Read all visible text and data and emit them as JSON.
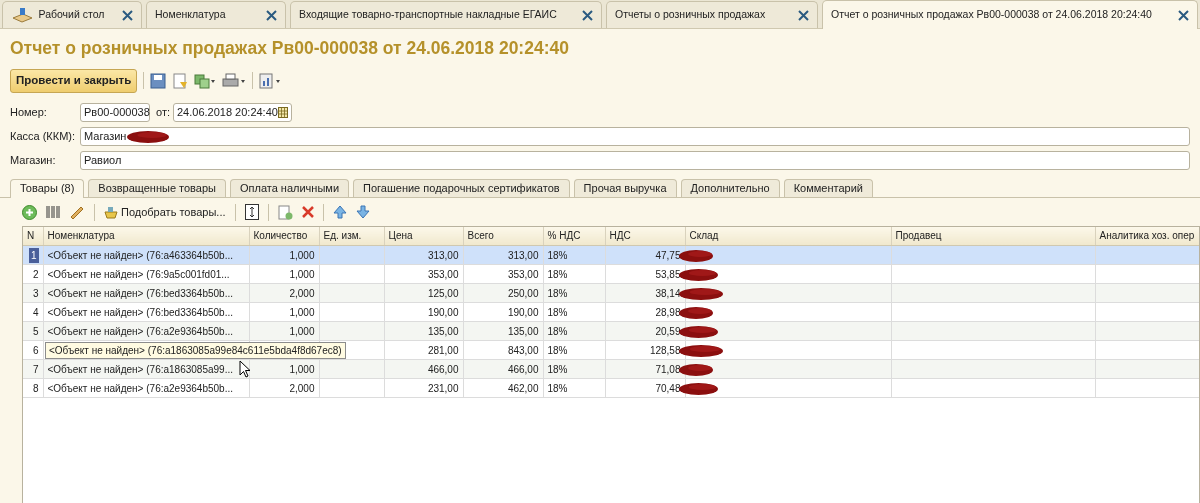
{
  "window_tabs": [
    {
      "label": "Рабочий стол",
      "kind": "desktop",
      "selected": false
    },
    {
      "label": "Номенклатура",
      "selected": false
    },
    {
      "label": "Входящие товарно-транспортные накладные ЕГАИС",
      "selected": false
    },
    {
      "label": "Отчеты о розничных продажах",
      "selected": false
    },
    {
      "label": "Отчет о розничных продажах Рв00-000038 от 24.06.2018 20:24:40",
      "selected": true
    }
  ],
  "title": "Отчет о розничных продажах Рв00-000038 от 24.06.2018 20:24:40",
  "toolbar": {
    "post_button": "Провести и закрыть"
  },
  "fields": {
    "number_label": "Номер:",
    "number_value": "Рв00-000038",
    "date_label": "от:",
    "date_value": "24.06.2018 20:24:40",
    "register_label": "Касса (ККМ):",
    "register_value": "Магазин",
    "shop_label": "Магазин:",
    "shop_value": "Равиол"
  },
  "inner_tabs": [
    {
      "label": "Товары (8)",
      "selected": true
    },
    {
      "label": "Возвращенные товары",
      "selected": false
    },
    {
      "label": "Оплата наличными",
      "selected": false
    },
    {
      "label": "Погашение подарочных сертификатов",
      "selected": false
    },
    {
      "label": "Прочая выручка",
      "selected": false
    },
    {
      "label": "Дополнительно",
      "selected": false
    },
    {
      "label": "Комментарий",
      "selected": false
    }
  ],
  "table_toolbar": {
    "pick_button": "Подобрать товары..."
  },
  "table": {
    "columns": [
      "N",
      "Номенклатура",
      "Количество",
      "Ед. изм.",
      "Цена",
      "Всего",
      "% НДС",
      "НДС",
      "Склад",
      "Продавец",
      "Аналитика хоз. опер"
    ],
    "rows": [
      {
        "n": "1",
        "item": "<Объект не найден> (76:a463364b50b...",
        "qty": "1,000",
        "price": "313,00",
        "total": "313,00",
        "vat_rate": "18%",
        "vat": "47,75",
        "selected": true
      },
      {
        "n": "2",
        "item": "<Объект не найден> (76:9a5c001fd01...",
        "qty": "1,000",
        "price": "353,00",
        "total": "353,00",
        "vat_rate": "18%",
        "vat": "53,85",
        "selected": false
      },
      {
        "n": "3",
        "item": "<Объект не найден> (76:bed3364b50b...",
        "qty": "2,000",
        "price": "125,00",
        "total": "250,00",
        "vat_rate": "18%",
        "vat": "38,14",
        "selected": false
      },
      {
        "n": "4",
        "item": "<Объект не найден> (76:bed3364b50b...",
        "qty": "1,000",
        "price": "190,00",
        "total": "190,00",
        "vat_rate": "18%",
        "vat": "28,98",
        "selected": false
      },
      {
        "n": "5",
        "item": "<Объект не найден> (76:a2e9364b50b...",
        "qty": "1,000",
        "price": "135,00",
        "total": "135,00",
        "vat_rate": "18%",
        "vat": "20,59",
        "selected": false
      },
      {
        "n": "6",
        "tooltip": "<Объект не найден> (76:a1863085a99e84c611e5bda4f8d67ec8)",
        "price": "281,00",
        "total": "843,00",
        "vat_rate": "18%",
        "vat": "128,58",
        "selected": false
      },
      {
        "n": "7",
        "item": "<Объект не найден> (76:a1863085a99...",
        "qty": "1,000",
        "price": "466,00",
        "total": "466,00",
        "vat_rate": "18%",
        "vat": "71,08",
        "selected": false
      },
      {
        "n": "8",
        "item": "<Объект не найден> (76:a2e9364b50b...",
        "qty": "2,000",
        "price": "231,00",
        "total": "462,00",
        "vat_rate": "18%",
        "vat": "70,48",
        "selected": false
      }
    ]
  }
}
